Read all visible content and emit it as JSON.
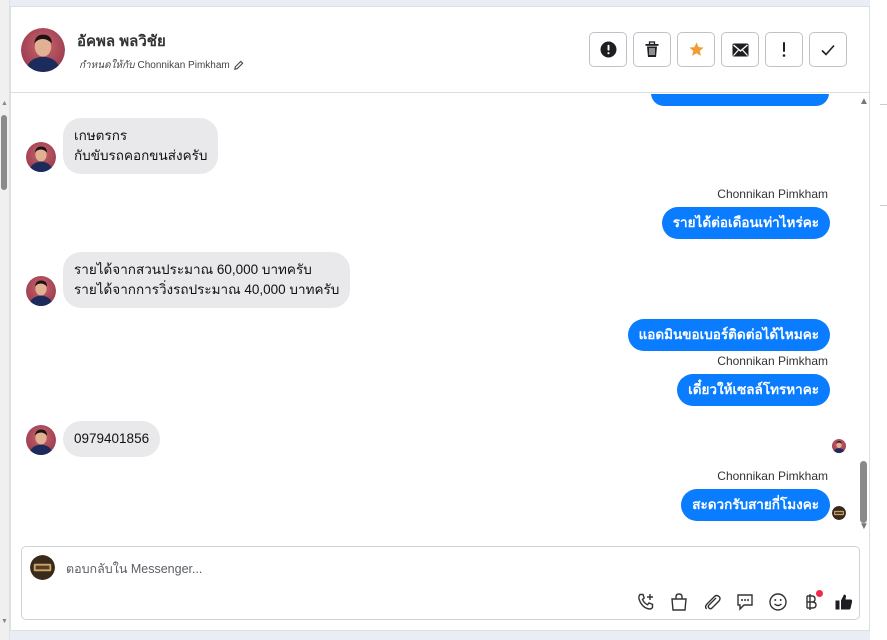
{
  "contact": {
    "name": "อัคพล พลวิชัย",
    "assign_label": "กำหนดให้กับ",
    "assignee": "Chonnikan Pimkham"
  },
  "header_actions": [
    {
      "name": "spam-button",
      "icon": "exclamation-circle-icon"
    },
    {
      "name": "delete-button",
      "icon": "trash-icon"
    },
    {
      "name": "star-button",
      "icon": "star-icon",
      "color": "#f29b33"
    },
    {
      "name": "mark-unread-button",
      "icon": "envelope-icon"
    },
    {
      "name": "follow-up-button",
      "icon": "exclamation-icon"
    },
    {
      "name": "mark-done-button",
      "icon": "check-icon"
    }
  ],
  "messages": [
    {
      "direction": "in",
      "lines": [
        "เกษตรกร",
        "กับขับรถคอกขนส่งครับ"
      ]
    },
    {
      "direction": "out",
      "sender": "Chonnikan Pimkham",
      "text": "รายได้ต่อเดือนเท่าไหร่คะ"
    },
    {
      "direction": "in",
      "lines": [
        "รายได้จากสวนประมาณ 60,000 บาทครับ",
        "รายได้จากการวิ่งรถประมาณ 40,000 บาทครับ"
      ]
    },
    {
      "direction": "out",
      "text": "แอดมินขอเบอร์ติดต่อได้ไหมคะ"
    },
    {
      "direction": "out",
      "sender": "Chonnikan Pimkham",
      "text": "เดี๋ยวให้เซลล์โทรหาคะ"
    },
    {
      "direction": "in",
      "lines": [
        "0979401856"
      ]
    },
    {
      "direction": "out",
      "sender": "Chonnikan Pimkham",
      "text": "สะดวกรับสายกี่โมงคะ"
    }
  ],
  "composer": {
    "placeholder": "ตอบกลับใน Messenger..."
  },
  "composer_tools": [
    "phone-plus-icon",
    "shopping-bag-icon",
    "paperclip-icon",
    "chat-bubble-icon",
    "smiley-icon",
    "baht-icon",
    "thumbs-up-icon"
  ],
  "colors": {
    "outgoing_bubble": "#0a7cff",
    "incoming_bubble": "#e9e9eb",
    "accent_star": "#f29b33",
    "notification_dot": "#f0284a"
  }
}
